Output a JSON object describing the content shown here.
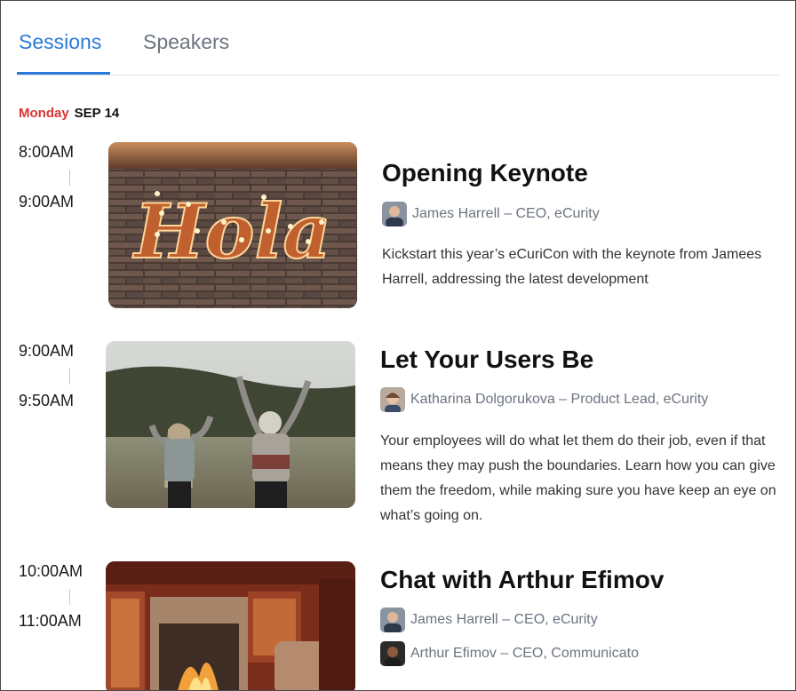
{
  "tabs": [
    {
      "label": "Sessions",
      "active": true
    },
    {
      "label": "Speakers",
      "active": false
    }
  ],
  "date": {
    "weekday": "Monday",
    "month_day": "SEP 14"
  },
  "colors": {
    "accent": "#2b7ad9",
    "weekday": "#d93434"
  },
  "sessions": [
    {
      "start": "8:00AM",
      "end": "9:00AM",
      "title": "Opening Keynote",
      "image": "hola-neon-sign-brick-wall",
      "speakers": [
        {
          "name": "James Harrell – CEO, eCurity",
          "avatar": "avatar-james-harrell"
        }
      ],
      "description": "Kickstart this year’s eCuriCon with the keynote from Jamees Harrell, addressing the latest development"
    },
    {
      "start": "9:00AM",
      "end": "9:50AM",
      "title": "Let Your Users Be",
      "image": "two-people-arms-raised-lake",
      "speakers": [
        {
          "name": "Katharina Dolgorukova – Product Lead, eCurity",
          "avatar": "avatar-katharina-dolgorukova"
        }
      ],
      "description": "Your employees will do what let them do their job, even if that means they may push the boundaries. Learn how you can give them the freedom, while making sure you have keep an eye on what’s going on."
    },
    {
      "start": "10:00AM",
      "end": "11:00AM",
      "title": "Chat with Arthur Efimov",
      "image": "fireplace-living-room",
      "speakers": [
        {
          "name": "James Harrell – CEO, eCurity",
          "avatar": "avatar-james-harrell"
        },
        {
          "name": "Arthur Efimov – CEO, Communicato",
          "avatar": "avatar-arthur-efimov"
        }
      ],
      "description": ""
    }
  ]
}
